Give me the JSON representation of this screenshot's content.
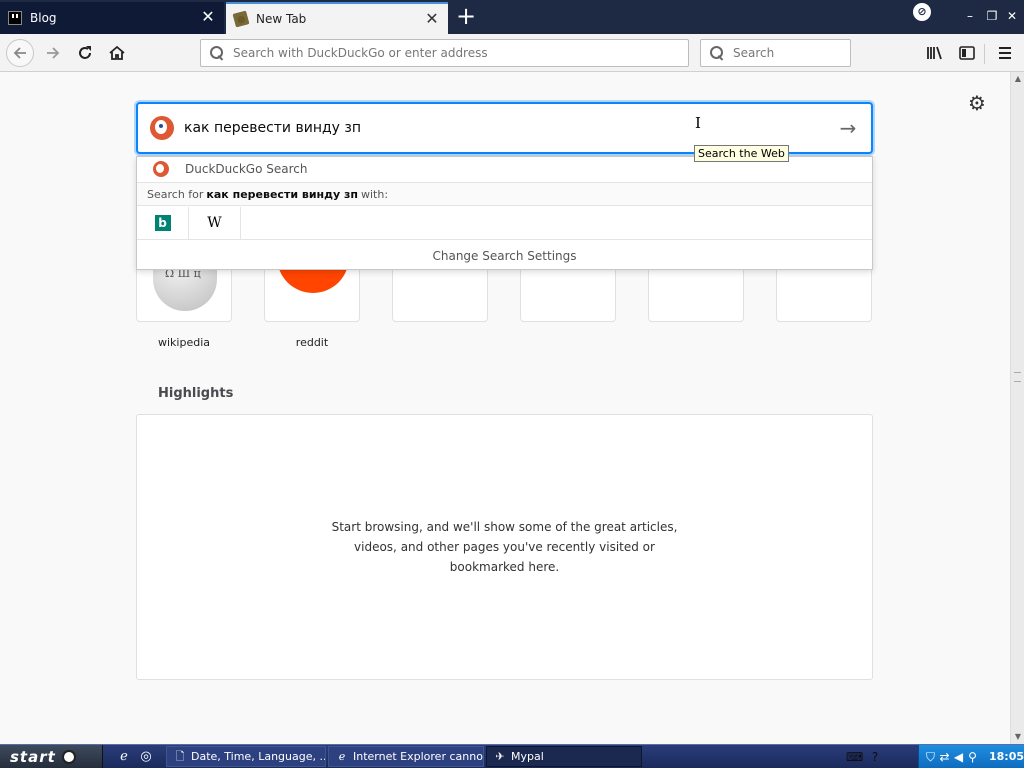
{
  "tabs": [
    {
      "title": "Blog"
    },
    {
      "title": "New Tab"
    }
  ],
  "navbar": {
    "url_placeholder": "Search with DuckDuckGo or enter address",
    "search_placeholder": "Search"
  },
  "search": {
    "query": "как перевести винду зп",
    "tooltip": "Search the Web"
  },
  "suggestions": {
    "engine_label": "DuckDuckGo Search",
    "search_for_prefix": "Search for",
    "search_for_query": "как перевести винду зп",
    "search_for_suffix": "with:",
    "engines": [
      "bing",
      "wikipedia"
    ],
    "change_settings": "Change Search Settings"
  },
  "topsites": [
    {
      "title": "wikipedia"
    },
    {
      "title": "reddit"
    },
    {
      "title": ""
    },
    {
      "title": ""
    },
    {
      "title": ""
    },
    {
      "title": ""
    }
  ],
  "highlights": {
    "title": "Highlights",
    "message": "Start browsing, and we'll show some of the great articles, videos, and other pages you've recently visited or bookmarked here."
  },
  "taskbar": {
    "start_label": "start",
    "tasks": [
      {
        "label": "Date, Time, Language, ..."
      },
      {
        "label": "Internet Explorer canno..."
      },
      {
        "label": "Mypal"
      }
    ],
    "clock": "18:05"
  },
  "colors": {
    "accent": "#0a84ff",
    "tab_bar": "#1e2a44",
    "ddg": "#de5833",
    "reddit": "#ff4500",
    "bing": "#008373"
  }
}
